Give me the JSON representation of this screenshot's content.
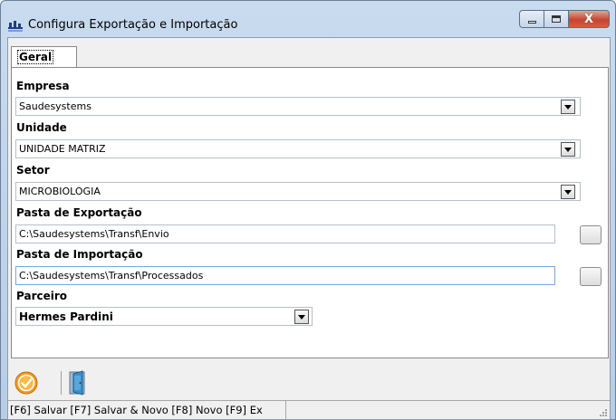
{
  "window": {
    "title": "Configura Exportação e Importação",
    "close_glyph": "X"
  },
  "tabs": [
    {
      "label": "Geral",
      "selected": true
    }
  ],
  "form": {
    "empresa": {
      "label": "Empresa",
      "value": "Saudesystems"
    },
    "unidade": {
      "label": "Unidade",
      "value": "UNIDADE MATRIZ"
    },
    "setor": {
      "label": "Setor",
      "value": "MICROBIOLOGIA"
    },
    "pasta_exportacao": {
      "label": "Pasta de Exportação",
      "value": "C:\\Saudesystems\\Transf\\Envio"
    },
    "pasta_importacao": {
      "label": "Pasta de Importação",
      "value": "C:\\Saudesystems\\Transf\\Processados"
    },
    "parceiro": {
      "label": "Parceiro",
      "value": "Hermes Pardini"
    }
  },
  "toolbar": {
    "icons": [
      "confirm-icon",
      "exit-door-icon"
    ]
  },
  "statusbar": {
    "text": "[F6] Salvar [F7] Salvar & Novo [F8] Novo [F9] Ex"
  },
  "colors": {
    "title_bar": "#b7cde6",
    "close_button": "#c7442e",
    "confirm_icon": "#f39a1e",
    "exit_icon": "#3b8fc9"
  }
}
